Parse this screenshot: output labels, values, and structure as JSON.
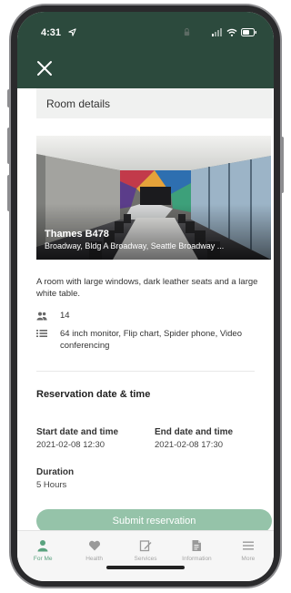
{
  "status_bar": {
    "time": "4:31"
  },
  "header": {
    "section_title": "Room details"
  },
  "room": {
    "name": "Thames B478",
    "address": "Broadway, Bldg A Broadway, Seattle Broadway ...",
    "description": "A room with large windows, dark leather seats and a large white table.",
    "capacity": "14",
    "amenities": "64 inch monitor, Flip chart, Spider phone, Video conferencing"
  },
  "reservation": {
    "heading": "Reservation date & time",
    "start_label": "Start date and time",
    "start_value": "2021-02-08 12:30",
    "end_label": "End date and time",
    "end_value": "2021-02-08 17:30",
    "duration_label": "Duration",
    "duration_value": "5 Hours"
  },
  "submit_label": "Submit reservation",
  "tabs": [
    {
      "label": "For Me",
      "icon": "person-icon",
      "active": true
    },
    {
      "label": "Health",
      "icon": "heart-icon",
      "active": false
    },
    {
      "label": "Services",
      "icon": "edit-icon",
      "active": false
    },
    {
      "label": "Information",
      "icon": "document-icon",
      "active": false
    },
    {
      "label": "More",
      "icon": "menu-icon",
      "active": false
    }
  ],
  "colors": {
    "header_bg": "#2c4a3d",
    "accent": "#5aa37f",
    "button_bg": "#95c3a9"
  }
}
